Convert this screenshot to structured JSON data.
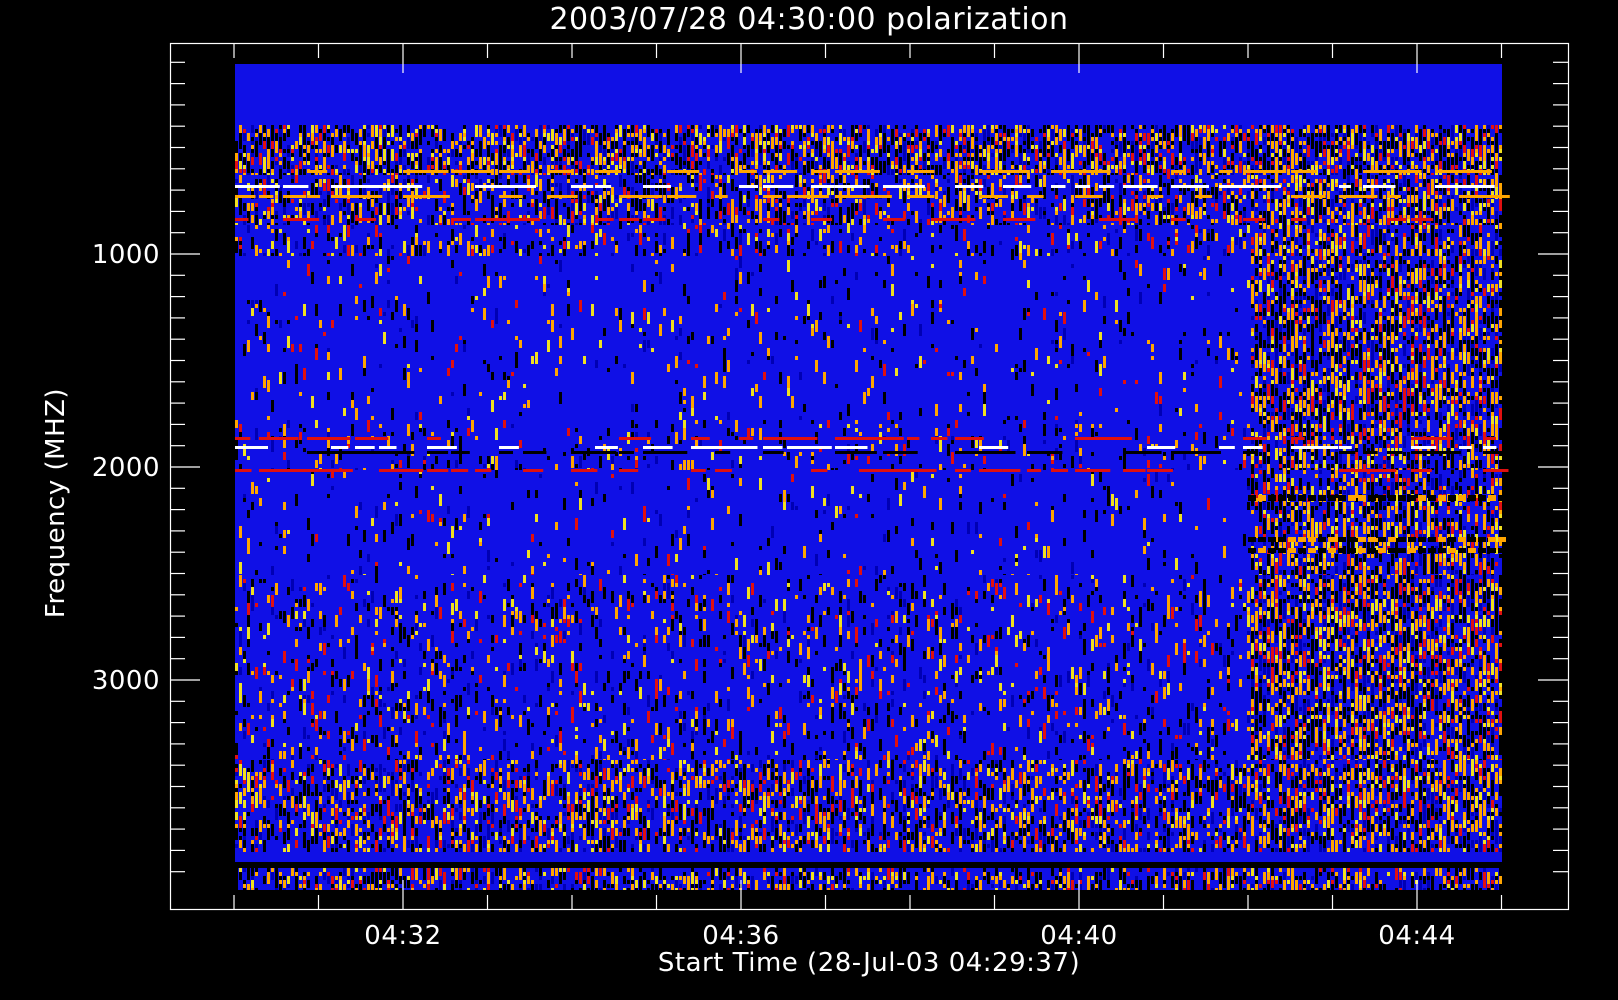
{
  "chart_data": {
    "type": "heatmap",
    "title": "2003/07/28 04:30:00 polarization",
    "xlabel": "Start Time (28-Jul-03 04:29:37)",
    "ylabel": "Frequency (MHZ)",
    "x_ticks": [
      "04:32",
      "04:36",
      "04:40",
      "04:44"
    ],
    "y_ticks": [
      "1000",
      "2000",
      "3000"
    ],
    "x_range": [
      "04:29:55",
      "04:44:55"
    ],
    "y_range": [
      100,
      4000
    ],
    "y_inverted": true,
    "burst_onset": "04:42",
    "colors": {
      "background": "#000000",
      "axis": "#ffffff",
      "base": "#1010e6",
      "base_alt": "#0000b4",
      "orange": "#ffa500",
      "yellow": "#f0e020",
      "red": "#e01010",
      "dark": "#000000",
      "white": "#ffffff"
    }
  }
}
